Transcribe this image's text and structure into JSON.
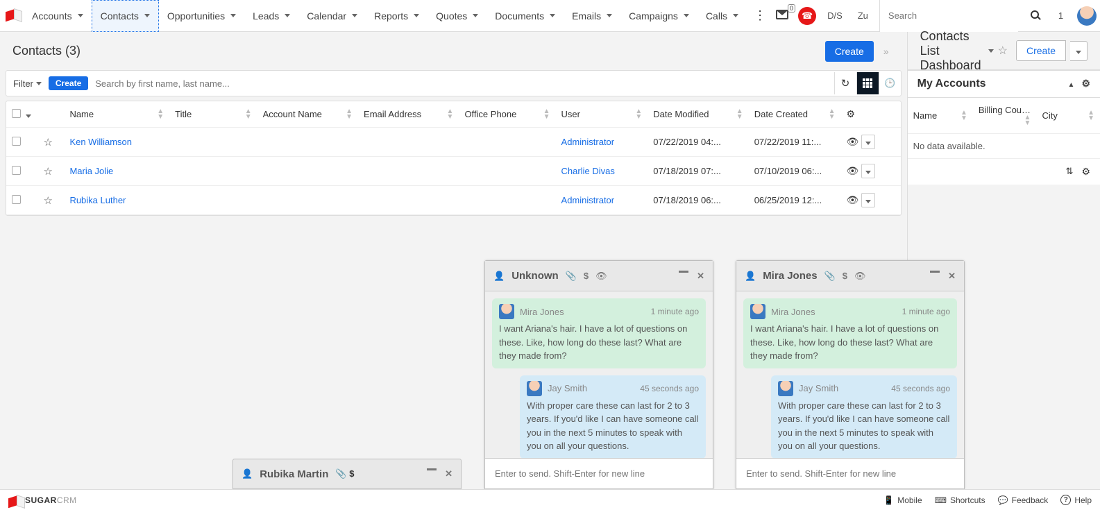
{
  "nav": {
    "items": [
      "Accounts",
      "Contacts",
      "Opportunities",
      "Leads",
      "Calendar",
      "Reports",
      "Quotes",
      "Documents",
      "Emails",
      "Campaigns",
      "Calls"
    ],
    "active_index": 1,
    "envelope_count": "0",
    "ds": "D/S",
    "zu": "Zu",
    "search_placeholder": "Search",
    "count_right": "1"
  },
  "left": {
    "title": "Contacts (3)",
    "create": "Create",
    "filter_label": "Filter",
    "filter_create": "Create",
    "filter_search_placeholder": "Search by first name, last name...",
    "columns": [
      "Name",
      "Title",
      "Account Name",
      "Email Address",
      "Office Phone",
      "User",
      "Date Modified",
      "Date Created"
    ],
    "rows": [
      {
        "name": "Ken Williamson",
        "title": "",
        "account": "",
        "email": "",
        "phone": "",
        "user": "Administrator",
        "modified": "07/22/2019 04:...",
        "created": "07/22/2019 11:..."
      },
      {
        "name": "Maria Jolie",
        "title": "",
        "account": "",
        "email": "",
        "phone": "",
        "user": "Charlie Divas",
        "modified": "07/18/2019 07:...",
        "created": "07/10/2019 06:..."
      },
      {
        "name": "Rubika Luther",
        "title": "",
        "account": "",
        "email": "",
        "phone": "",
        "user": "Administrator",
        "modified": "07/18/2019 06:...",
        "created": "06/25/2019 12:..."
      }
    ]
  },
  "right": {
    "title": "Contacts List Dashboard",
    "create": "Create",
    "widget_title": "My Accounts",
    "acct_columns": [
      "Name",
      "Billing Country",
      "City"
    ],
    "nodata": "No data available."
  },
  "chats": {
    "input_placeholder": "Enter to send. Shift-Enter for new line",
    "collapsed": {
      "name": "Rubika Martin"
    },
    "win1": {
      "name": "Unknown",
      "msgs": [
        {
          "cls": "green",
          "name": "Mira Jones",
          "time": "1 minute ago",
          "text": "I want Ariana's hair. I have a lot of questions on these. Like, how long do these last? What are they made from?"
        },
        {
          "cls": "blue",
          "name": "Jay Smith",
          "time": "45 seconds ago",
          "text": "With proper care these can last for 2 to 3 years. If you'd like I can have someone call you in the next 5 minutes to speak with you on all your questions."
        }
      ]
    },
    "win2": {
      "name": "Mira Jones",
      "msgs": [
        {
          "cls": "green",
          "name": "Mira Jones",
          "time": "1 minute ago",
          "text": "I want Ariana's hair. I have a lot of questions on these. Like, how long do these last? What are they made from?"
        },
        {
          "cls": "blue",
          "name": "Jay Smith",
          "time": "45 seconds ago",
          "text": "With proper care these can last for 2 to 3 years. If you'd like I can have someone call you in the next 5 minutes to speak with you on all your questions."
        }
      ]
    }
  },
  "footer": {
    "brand_a": "SUGAR",
    "brand_b": "CRM",
    "links": [
      "Mobile",
      "Shortcuts",
      "Feedback",
      "Help"
    ]
  }
}
